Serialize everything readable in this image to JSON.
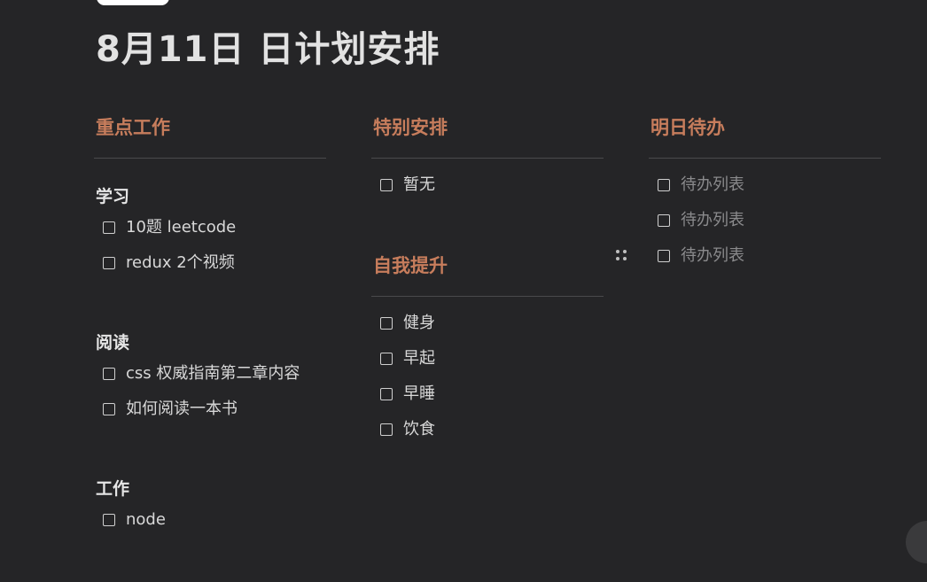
{
  "page": {
    "title": "8月11日 日计划安排"
  },
  "columns": [
    {
      "heading": "重点工作",
      "groups": [
        {
          "title": "学习",
          "items": [
            "10题 leetcode",
            "redux 2个视频"
          ]
        },
        {
          "title": "阅读",
          "items": [
            "css 权威指南第二章内容",
            "如何阅读一本书"
          ]
        },
        {
          "title": "工作",
          "items": [
            "node"
          ]
        }
      ]
    },
    {
      "sections": [
        {
          "heading": "特别安排",
          "items": [
            "暂无"
          ]
        },
        {
          "heading": "自我提升",
          "items": [
            "健身",
            "早起",
            "早睡",
            "饮食"
          ]
        }
      ]
    },
    {
      "heading": "明日待办",
      "items": [
        "待办列表",
        "待办列表",
        "待办列表"
      ]
    }
  ],
  "icons": {
    "drag_handle": "drag-handle-icon",
    "checkbox": "checkbox-icon"
  },
  "colors": {
    "background": "#252527",
    "heading_accent": "#c77d5c",
    "text": "#d8d8d8",
    "placeholder_text": "#8a8a8c"
  }
}
